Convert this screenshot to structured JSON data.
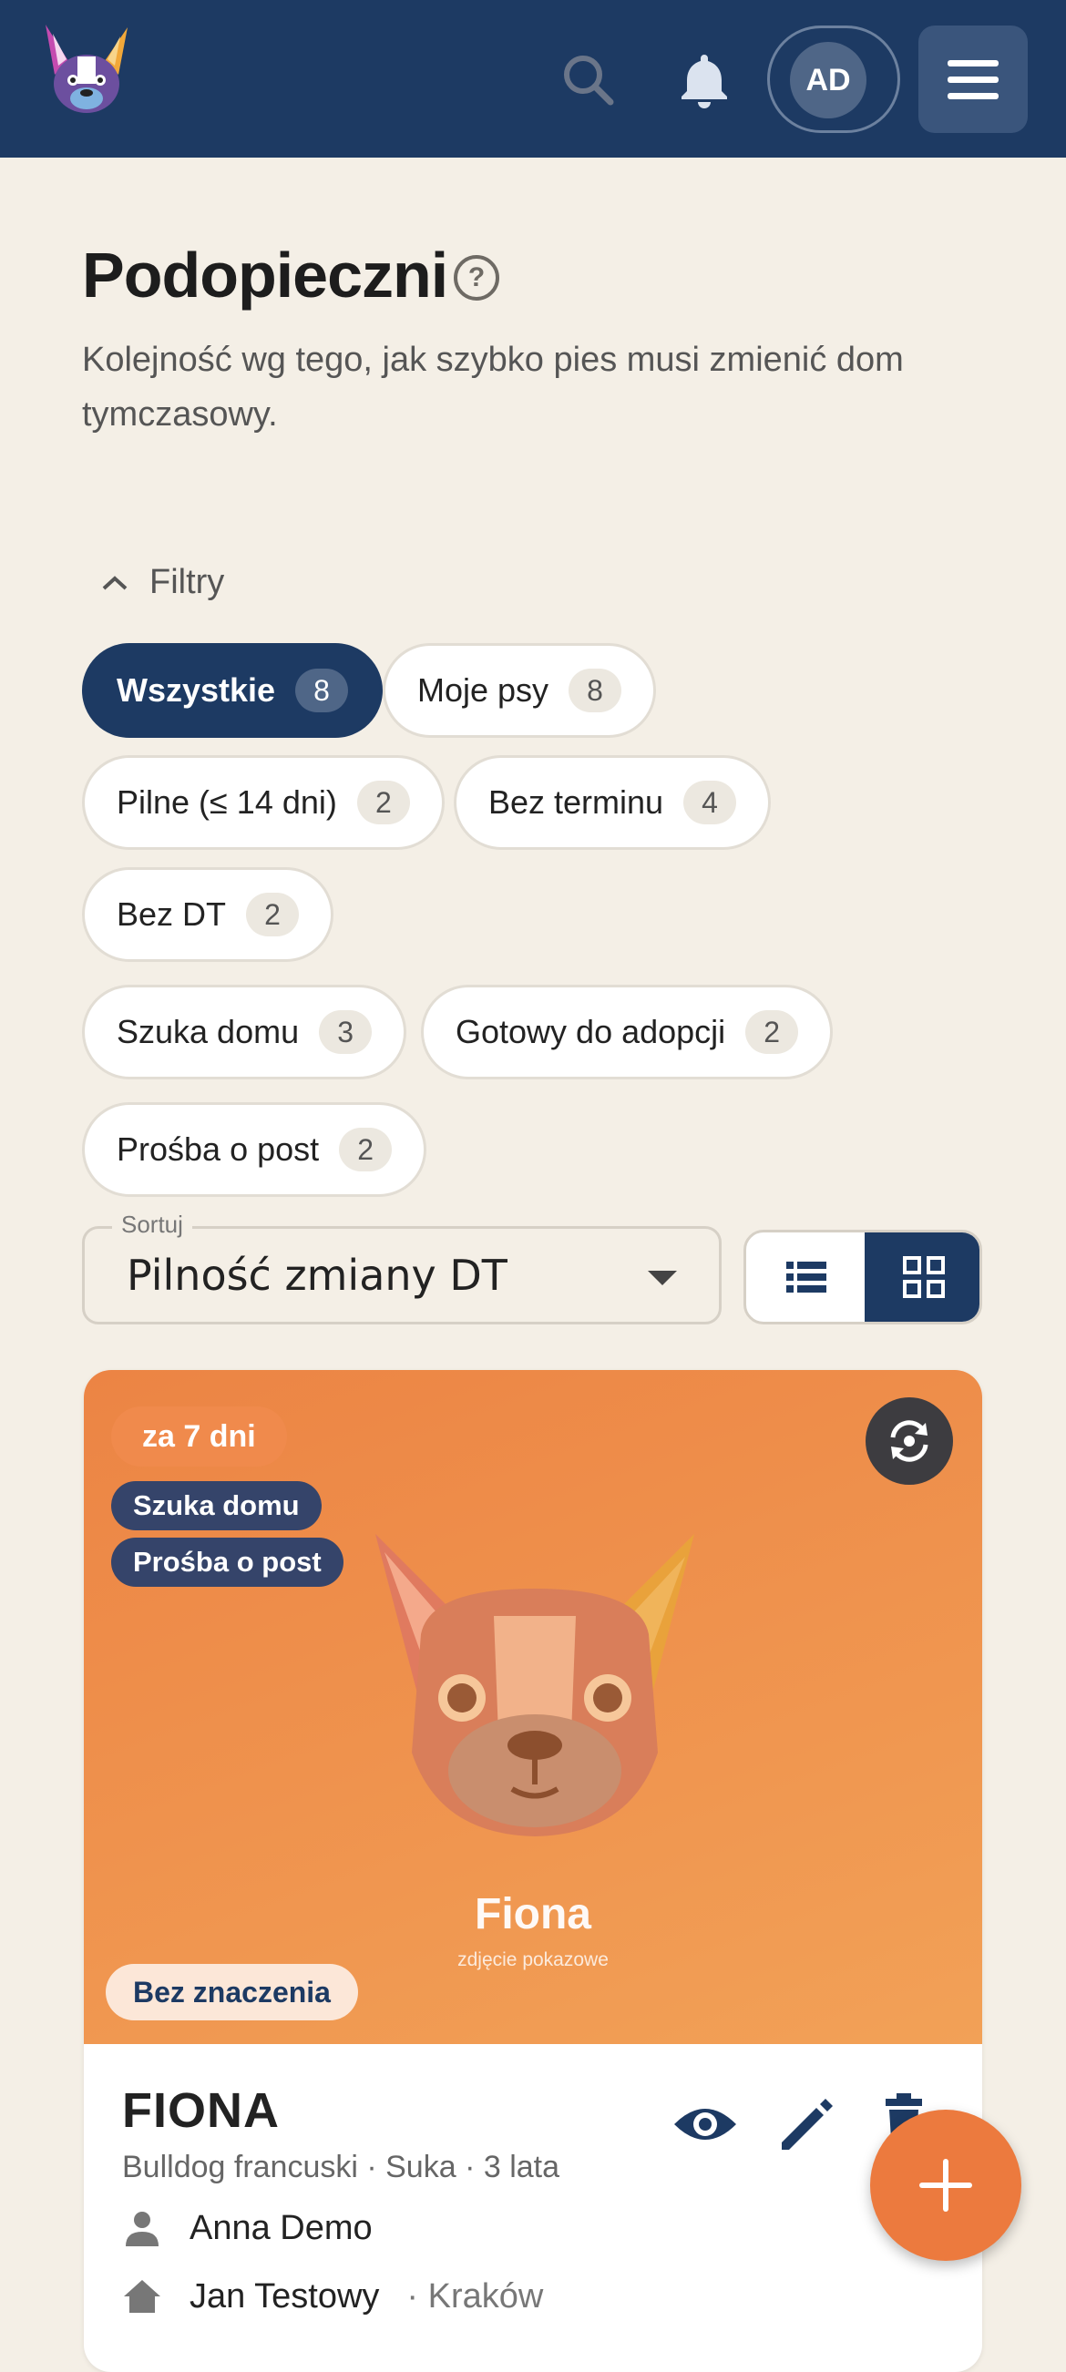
{
  "header": {
    "avatar_initials": "AD",
    "icons": [
      "dog-logo-icon",
      "search-icon",
      "bell-icon",
      "menu-icon"
    ],
    "colors": {
      "bar": "#1d3a63",
      "accent": "#ec7a3e"
    }
  },
  "page": {
    "title": "Podopieczni",
    "subtitle": "Kolejność wg tego, jak szybko pies musi zmienić dom tymczasowy."
  },
  "filters": {
    "toggle_label": "Filtry",
    "chips": [
      {
        "label": "Wszystkie",
        "count": "8",
        "active": true
      },
      {
        "label": "Moje psy",
        "count": "8"
      },
      {
        "label": "Pilne (≤ 14 dni)",
        "count": "2"
      },
      {
        "label": "Bez terminu",
        "count": "4"
      },
      {
        "label": "Bez DT",
        "count": "2"
      },
      {
        "label": "Szuka domu",
        "count": "3"
      },
      {
        "label": "Gotowy do adopcji",
        "count": "2"
      },
      {
        "label": "Prośba o post",
        "count": "2"
      }
    ]
  },
  "sort": {
    "label": "Sortuj",
    "value": "Pilność zmiany DT",
    "view_modes": [
      "list",
      "grid"
    ],
    "selected_view": "grid"
  },
  "card": {
    "due": "za 7 dni",
    "tags": [
      "Szuka domu",
      "Prośba o post"
    ],
    "image_name": "Fiona",
    "image_caption": "zdjęcie pokazowe",
    "priority": "Bez znaczenia",
    "name": "FIONA",
    "meta": "Bulldog francuski · Suka · 3 lata",
    "owner": "Anna Demo",
    "foster": "Jan Testowy",
    "city": "· Kraków"
  },
  "fab": {
    "icon": "plus-icon"
  }
}
